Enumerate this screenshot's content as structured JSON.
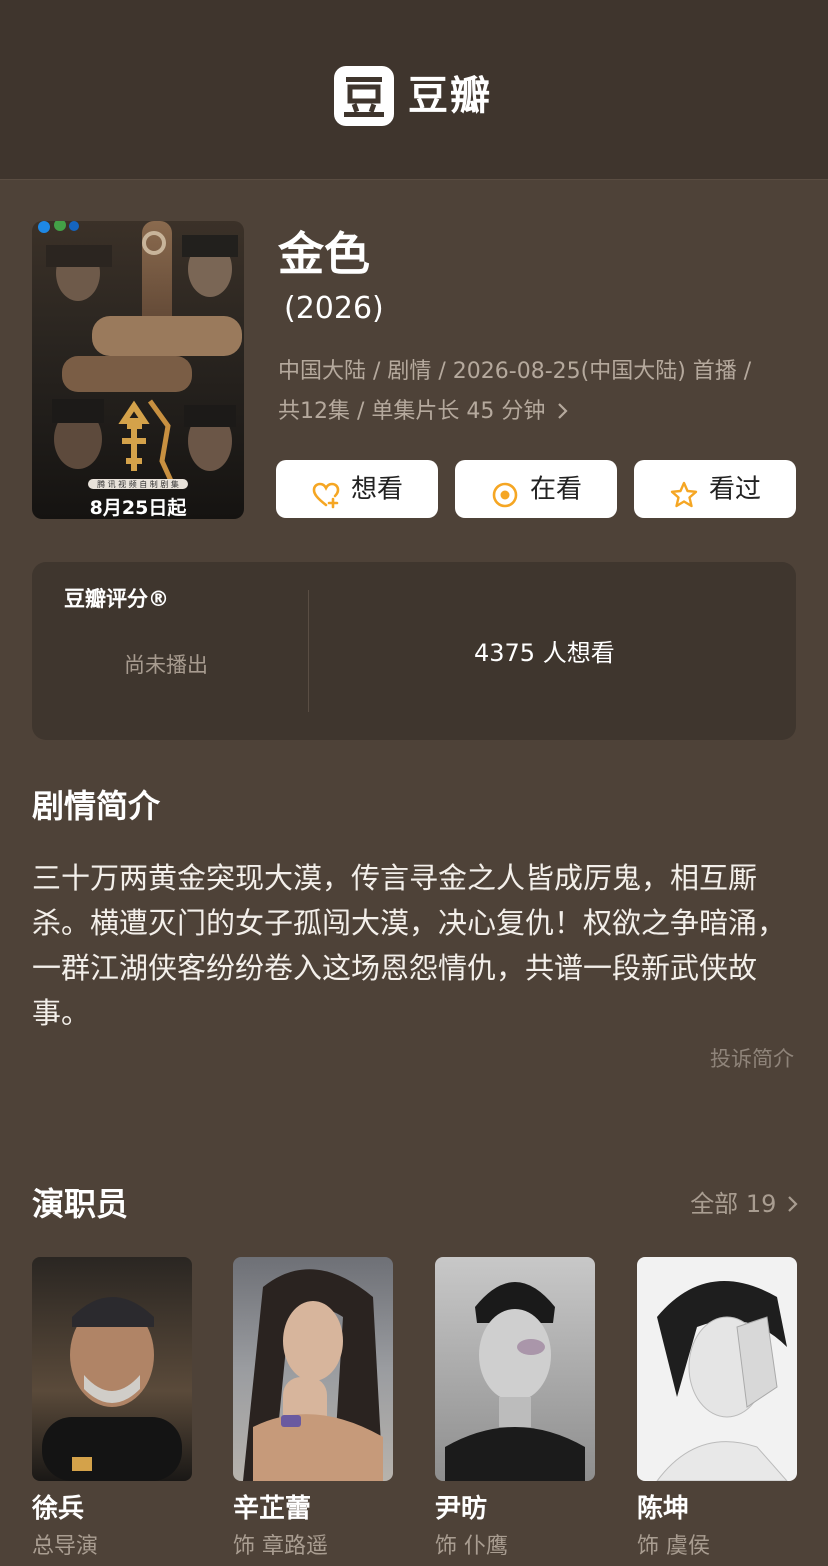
{
  "header": {
    "logo_glyph": "豆",
    "app_name": "豆瓣"
  },
  "poster": {
    "date_text": "8月25日起"
  },
  "show": {
    "title": "金色",
    "year": "(2026)",
    "meta_line1": "中国大陆 / 剧情 / 2026-08-25(中国大陆) 首播 /",
    "meta_line2": "共12集 / 单集片长 45 分钟"
  },
  "actions": {
    "want": "想看",
    "watching": "在看",
    "watched": "看过"
  },
  "rating": {
    "title": "豆瓣评分®",
    "status": "尚未播出",
    "wish_count": "4375 人想看"
  },
  "synopsis": {
    "heading": "剧情简介",
    "text": "三十万两黄金突现大漠，传言寻金之人皆成厉鬼，相互厮杀。横遭灭门的女子孤闯大漠，决心复仇！权欲之争暗涌，一群江湖侠客纷纷卷入这场恩怨情仇，共谱一段新武侠故事。",
    "report_link": "投诉简介"
  },
  "cast": {
    "heading": "演职员",
    "all_label": "全部 19",
    "members": [
      {
        "name": "徐兵",
        "role": "总导演"
      },
      {
        "name": "辛芷蕾",
        "role": "饰 章路遥"
      },
      {
        "name": "尹昉",
        "role": "饰 仆鹰"
      },
      {
        "name": "陈坤",
        "role": "饰 虞侯"
      }
    ]
  },
  "colors": {
    "background": "#4e4238",
    "header_bg": "#3f352d",
    "card_bg": "#3f362e",
    "accent_yellow": "#f5a623",
    "muted_text": "#b5a99d"
  }
}
